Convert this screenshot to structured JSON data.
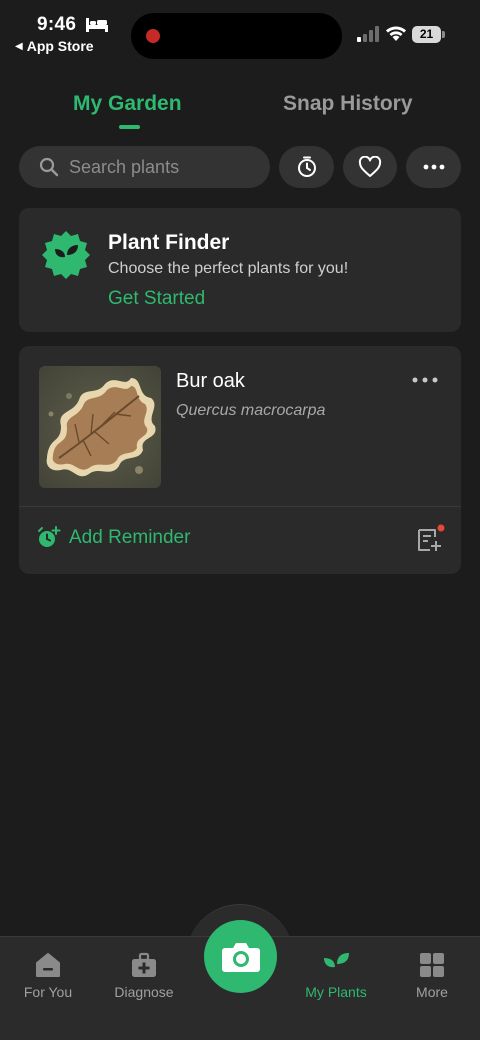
{
  "status_bar": {
    "time": "9:46",
    "back_label": "App Store",
    "battery": "21",
    "icons": [
      "bed-icon",
      "signal-icon",
      "wifi-icon",
      "battery-icon"
    ],
    "recording_color": "#c62a26"
  },
  "tabs": [
    {
      "label": "My Garden",
      "active": true
    },
    {
      "label": "Snap History",
      "active": false
    }
  ],
  "search": {
    "placeholder": "Search plants",
    "value": ""
  },
  "toolbar": {
    "buttons": [
      "timer-icon",
      "heart-icon",
      "more-icon"
    ]
  },
  "plant_finder": {
    "title": "Plant Finder",
    "subtitle": "Choose the perfect plants for you!",
    "cta": "Get Started"
  },
  "plants": [
    {
      "name": "Bur oak",
      "scientific_name": "Quercus macrocarpa",
      "add_reminder": "Add Reminder"
    }
  ],
  "bottom_nav": {
    "items": [
      {
        "label": "For You",
        "icon": "home-icon",
        "active": false
      },
      {
        "label": "Diagnose",
        "icon": "medkit-icon",
        "active": false
      },
      {
        "label": "My Plants",
        "icon": "sprout-icon",
        "active": true
      },
      {
        "label": "More",
        "icon": "grid-icon",
        "active": false
      }
    ],
    "camera_icon": "camera-icon"
  },
  "colors": {
    "accent": "#2fb86f",
    "background": "#1c1c1c",
    "card": "#2a2a2a",
    "notification_dot": "#e5483a"
  }
}
